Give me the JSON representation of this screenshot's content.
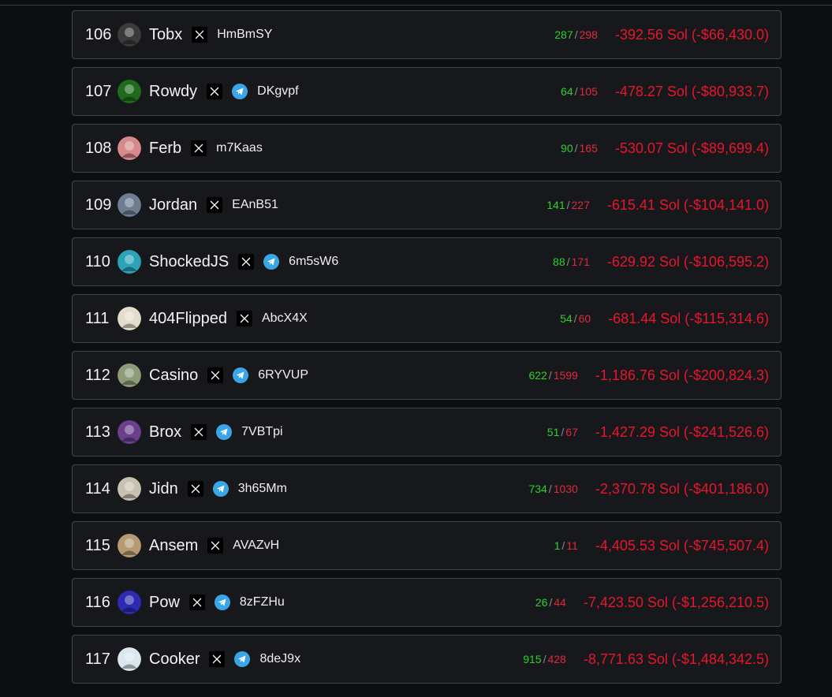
{
  "leaderboard": {
    "rows": [
      {
        "rank": "106",
        "name": "Tobx",
        "twitter": true,
        "telegram": false,
        "wallet": "HmBmSY",
        "wins": "287",
        "trades": "298",
        "pnl": "-392.56 Sol (-$66,430.0)",
        "avatar_color": "#3a3a3a",
        "avatar_icon": "dark-figure-avatar"
      },
      {
        "rank": "107",
        "name": "Rowdy",
        "twitter": true,
        "telegram": true,
        "wallet": "DKgvpf",
        "wins": "64",
        "trades": "105",
        "pnl": "-478.27 Sol (-$80,933.7)",
        "avatar_color": "#1f6b1a",
        "avatar_icon": "green-creature-avatar"
      },
      {
        "rank": "108",
        "name": "Ferb",
        "twitter": true,
        "telegram": false,
        "wallet": "m7Kaas",
        "wins": "90",
        "trades": "165",
        "pnl": "-530.07 Sol (-$89,699.4)",
        "avatar_color": "#d8898c",
        "avatar_icon": "face-avatar"
      },
      {
        "rank": "109",
        "name": "Jordan",
        "twitter": true,
        "telegram": false,
        "wallet": "EAnB51",
        "wins": "141",
        "trades": "227",
        "pnl": "-615.41 Sol (-$104,141.0)",
        "avatar_color": "#6f7d92",
        "avatar_icon": "photo-avatar"
      },
      {
        "rank": "110",
        "name": "ShockedJS",
        "twitter": true,
        "telegram": true,
        "wallet": "6m5sW6",
        "wins": "88",
        "trades": "171",
        "pnl": "-629.92 Sol (-$106,595.2)",
        "avatar_color": "#2aa3b8",
        "avatar_icon": "crewmate-avatar"
      },
      {
        "rank": "111",
        "name": "404Flipped",
        "twitter": true,
        "telegram": false,
        "wallet": "AbcX4X",
        "wins": "54",
        "trades": "60",
        "pnl": "-681.44 Sol (-$115,314.6)",
        "avatar_color": "#e6dccb",
        "avatar_icon": "cartoon-avatar"
      },
      {
        "rank": "112",
        "name": "Casino",
        "twitter": true,
        "telegram": true,
        "wallet": "6RYVUP",
        "wins": "622",
        "trades": "1599",
        "pnl": "-1,186.76 Sol (-$200,824.3)",
        "avatar_color": "#8e9b78",
        "avatar_icon": "character-avatar"
      },
      {
        "rank": "113",
        "name": "Brox",
        "twitter": true,
        "telegram": true,
        "wallet": "7VBTpi",
        "wins": "51",
        "trades": "67",
        "pnl": "-1,427.29 Sol (-$241,526.6)",
        "avatar_color": "#6a3f8c",
        "avatar_icon": "skull-avatar"
      },
      {
        "rank": "114",
        "name": "Jidn",
        "twitter": true,
        "telegram": true,
        "wallet": "3h65Mm",
        "wins": "734",
        "trades": "1030",
        "pnl": "-2,370.78 Sol (-$401,186.0)",
        "avatar_color": "#c9c1b0",
        "avatar_icon": "figure-avatar"
      },
      {
        "rank": "115",
        "name": "Ansem",
        "twitter": true,
        "telegram": false,
        "wallet": "AVAZvH",
        "wins": "1",
        "trades": "11",
        "pnl": "-4,405.53 Sol (-$745,507.4)",
        "avatar_color": "#b69a72",
        "avatar_icon": "dog-avatar"
      },
      {
        "rank": "116",
        "name": "Pow",
        "twitter": true,
        "telegram": true,
        "wallet": "8zFZHu",
        "wins": "26",
        "trades": "44",
        "pnl": "-7,423.50 Sol (-$1,256,210.5)",
        "avatar_color": "#2c2ab0",
        "avatar_icon": "blue-character-avatar"
      },
      {
        "rank": "117",
        "name": "Cooker",
        "twitter": true,
        "telegram": true,
        "wallet": "8deJ9x",
        "wins": "915",
        "trades": "428",
        "pnl": "-8,771.63 Sol (-$1,484,342.5)",
        "avatar_color": "#d9e8ee",
        "avatar_icon": "anime-avatar"
      }
    ]
  },
  "colors": {
    "wins": "#2bd12b",
    "total": "#e0283a",
    "pnl_negative": "#e8152d",
    "telegram": "#3aa6e8"
  }
}
